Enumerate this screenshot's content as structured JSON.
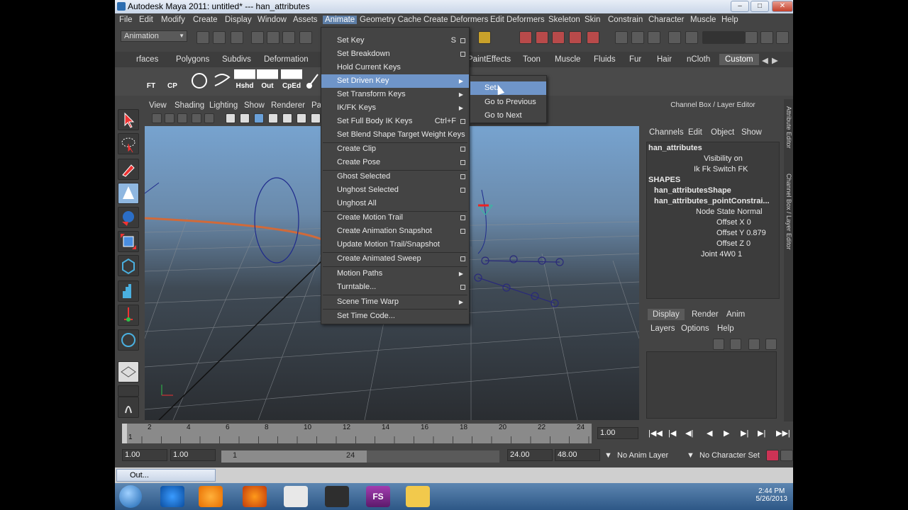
{
  "window": {
    "title": "Autodesk Maya 2011: untitled*   ---   han_attributes",
    "minimize": "–",
    "maximize": "□",
    "close": "✕"
  },
  "menubar": [
    "File",
    "Edit",
    "Modify",
    "Create",
    "Display",
    "Window",
    "Assets",
    "Animate",
    "Geometry Cache",
    "Create Deformers",
    "Edit Deformers",
    "Skeleton",
    "Skin",
    "Constrain",
    "Character",
    "Muscle",
    "Help"
  ],
  "statusline": {
    "mode": "Animation"
  },
  "shelf_tabs": [
    "rfaces",
    "Polygons",
    "Subdivs",
    "Deformation",
    "PaintEffects",
    "Toon",
    "Muscle",
    "Fluids",
    "Fur",
    "Hair",
    "nCloth",
    "Custom"
  ],
  "shelf_buttons": [
    "FT",
    "CP",
    "Hshd",
    "Out",
    "CpEd"
  ],
  "viewport_menu": [
    "View",
    "Shading",
    "Lighting",
    "Show",
    "Renderer",
    "Pa"
  ],
  "animate_menu": [
    {
      "label": "Set Key",
      "shortcut": "S",
      "option": true
    },
    {
      "label": "Set Breakdown",
      "option": true
    },
    {
      "label": "Hold Current Keys"
    },
    {
      "label": "Set Driven Key",
      "submenu": true,
      "highlighted": true
    },
    {
      "label": "Set Transform Keys",
      "submenu": true
    },
    {
      "label": "IK/FK Keys",
      "submenu": true
    },
    {
      "label": "Set Full Body IK Keys",
      "shortcut": "Ctrl+F",
      "option": true
    },
    {
      "label": "Set Blend Shape Target Weight Keys"
    },
    {
      "label": "Create Clip",
      "option": true
    },
    {
      "label": "Create Pose",
      "option": true
    },
    {
      "label": "Ghost Selected",
      "option": true
    },
    {
      "label": "Unghost Selected",
      "option": true
    },
    {
      "label": "Unghost All"
    },
    {
      "label": "Create Motion Trail",
      "option": true
    },
    {
      "label": "Create Animation Snapshot",
      "option": true
    },
    {
      "label": "Update Motion Trail/Snapshot"
    },
    {
      "label": "Create Animated Sweep",
      "option": true
    },
    {
      "label": "Motion Paths",
      "submenu": true
    },
    {
      "label": "Turntable...",
      "option": true
    },
    {
      "label": "Scene Time Warp",
      "submenu": true
    },
    {
      "label": "Set Time Code..."
    }
  ],
  "driven_key_submenu": [
    "Set...",
    "Go to Previous",
    "Go to Next"
  ],
  "channel_box": {
    "header": "Channel Box / Layer Editor",
    "menu": [
      "Channels",
      "Edit",
      "Object",
      "Show"
    ],
    "object": "han_attributes",
    "attrs": [
      {
        "label": "Visibility",
        "value": "on"
      },
      {
        "label": "Ik Fk Switch",
        "value": "FK"
      }
    ],
    "shapes_label": "SHAPES",
    "shape_nodes": [
      "han_attributesShape",
      "han_attributes_pointConstrai..."
    ],
    "constraint_attrs": [
      {
        "label": "Node State",
        "value": "Normal"
      },
      {
        "label": "Offset X",
        "value": "0"
      },
      {
        "label": "Offset Y",
        "value": "0.879"
      },
      {
        "label": "Offset Z",
        "value": "0"
      },
      {
        "label": "Joint 4W0",
        "value": "1"
      }
    ],
    "side_tabs": [
      "Attribute Editor",
      "Channel Box / Layer Editor"
    ]
  },
  "layer_editor": {
    "tabs": [
      "Display",
      "Render",
      "Anim"
    ],
    "menu": [
      "Layers",
      "Options",
      "Help"
    ]
  },
  "timeline": {
    "start_tick": "1",
    "ticks": [
      "2",
      "4",
      "6",
      "8",
      "10",
      "12",
      "14",
      "16",
      "18",
      "20",
      "22",
      "24"
    ],
    "current": "1.00"
  },
  "range": {
    "start": "1.00",
    "playback_start": "1.00",
    "thumb_start": "1",
    "thumb_end": "24",
    "playback_end": "24.00",
    "end": "48.00",
    "anim_layer": "No Anim Layer",
    "character_set": "No Character Set"
  },
  "minimized_window": "Out...",
  "clock": {
    "time": "2:44 PM",
    "date": "5/26/2013"
  }
}
